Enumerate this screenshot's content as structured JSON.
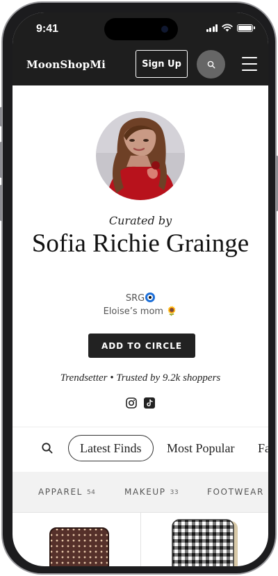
{
  "status_bar": {
    "time": "9:41"
  },
  "nav": {
    "brand": "MoonShopMi",
    "signup_label": "Sign Up"
  },
  "profile": {
    "curated_by": "Curated by",
    "name": "Sofia Richie Grainge",
    "handle": "SRG",
    "bio_text": "Eloise’s mom",
    "bio_emoji": "🌻",
    "add_button": "ADD TO CIRCLE",
    "tagline": "Trendsetter • Trusted by 9.2k shoppers"
  },
  "tabs": [
    {
      "label": "Latest Finds",
      "active": true
    },
    {
      "label": "Most Popular",
      "active": false
    },
    {
      "label": "Fa",
      "active": false
    }
  ],
  "categories": [
    {
      "label": "APPAREL",
      "count": "54"
    },
    {
      "label": "MAKEUP",
      "count": "33"
    },
    {
      "label": "FOOTWEAR",
      "count": ""
    }
  ],
  "icons": {
    "search": "search-icon",
    "menu": "menu-icon",
    "instagram": "instagram-icon",
    "tiktok": "tiktok-icon",
    "nazar": "evil-eye-icon"
  },
  "colors": {
    "header_bg": "#1e1e1e",
    "button_bg": "#222222",
    "category_bg": "#f2f2f2",
    "avatar_dress": "#b8121c"
  }
}
